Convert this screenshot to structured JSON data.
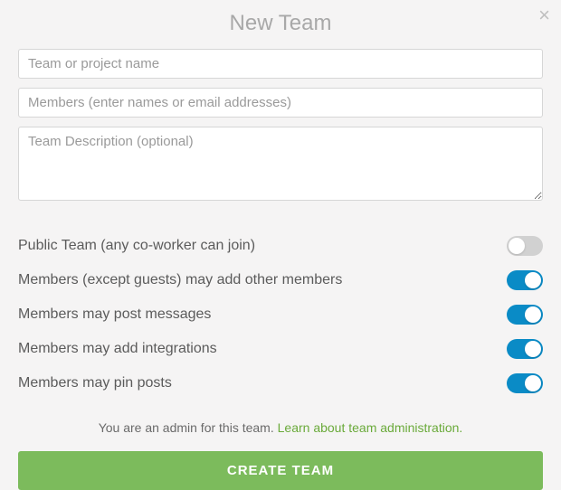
{
  "title": "New Team",
  "fields": {
    "name_placeholder": "Team or project name",
    "members_placeholder": "Members (enter names or email addresses)",
    "description_placeholder": "Team Description (optional)"
  },
  "options": [
    {
      "label": "Public Team (any co-worker can join)",
      "on": false
    },
    {
      "label": "Members (except guests) may add other members",
      "on": true
    },
    {
      "label": "Members may post messages",
      "on": true
    },
    {
      "label": "Members may add integrations",
      "on": true
    },
    {
      "label": "Members may pin posts",
      "on": true
    }
  ],
  "admin_text": "You are an admin for this team. ",
  "admin_link": "Learn about team administration.",
  "create_label": "CREATE TEAM"
}
